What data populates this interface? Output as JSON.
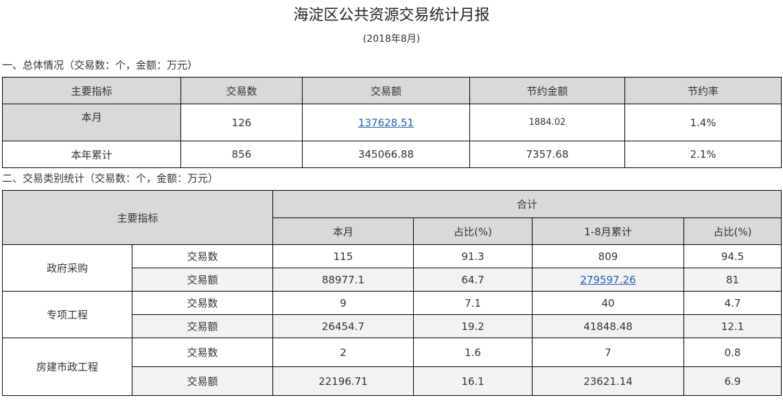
{
  "title": "海淀区公共资源交易统计月报",
  "subtitle": "(2018年8月)",
  "section1": {
    "title": "一、总体情况（交易数：个，金额：万元）",
    "headers": [
      "主要指标",
      "交易数",
      "交易额",
      "节约金额",
      "节约率"
    ],
    "rows": [
      [
        "本月",
        "126",
        "137628.51",
        "1884.02",
        "1.4%"
      ],
      [
        "本年累计",
        "856",
        "345066.88",
        "7357.68",
        "2.1%"
      ]
    ]
  },
  "section2": {
    "title": "二、交易类别统计（交易数：个，金额：万元）",
    "header_main": "主要指标",
    "header_total": "合计",
    "subheaders": [
      "本月",
      "占比(%)",
      "1-8月累计",
      "占比(%)"
    ],
    "groups": [
      {
        "name": "政府采购",
        "rows": [
          [
            "交易数",
            "115",
            "91.3",
            "809",
            "94.5"
          ],
          [
            "交易额",
            "88977.1",
            "64.7",
            "279597.26",
            "81"
          ]
        ]
      },
      {
        "name": "专项工程",
        "rows": [
          [
            "交易数",
            "9",
            "7.1",
            "40",
            "4.7"
          ],
          [
            "交易额",
            "26454.7",
            "19.2",
            "41848.48",
            "12.1"
          ]
        ]
      },
      {
        "name": "房建市政工程",
        "rows": [
          [
            "交易数",
            "2",
            "1.6",
            "7",
            "0.8"
          ],
          [
            "交易额",
            "22196.71",
            "16.1",
            "23621.14",
            "6.9"
          ]
        ]
      }
    ]
  }
}
